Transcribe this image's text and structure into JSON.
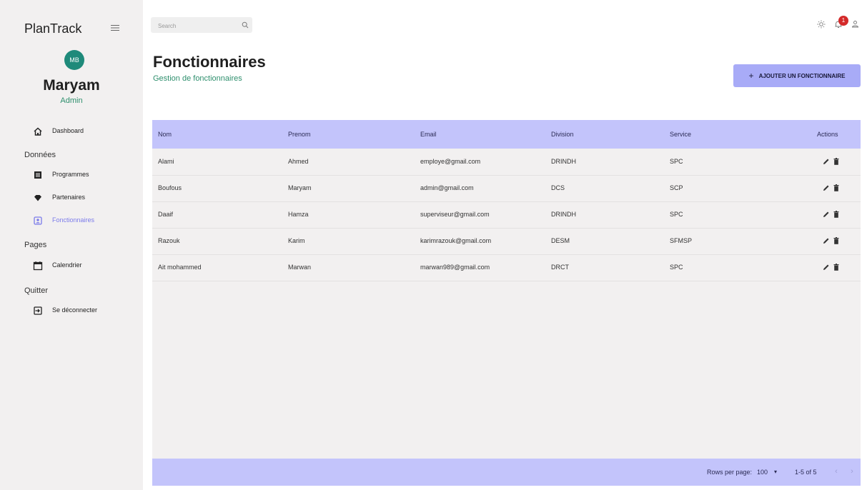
{
  "app": {
    "brand": "PlanTrack"
  },
  "user": {
    "initials": "MB",
    "name": "Maryam",
    "role": "Admin"
  },
  "sidebar": {
    "dashboard": "Dashboard",
    "section_donnees": "Données",
    "programmes": "Programmes",
    "partenaires": "Partenaires",
    "fonctionnaires": "Fonctionnaires",
    "section_pages": "Pages",
    "calendrier": "Calendrier",
    "section_quitter": "Quitter",
    "logout": "Se déconnecter",
    "active_item": "Fonctionnaires"
  },
  "header": {
    "search_placeholder": "Search",
    "notification_count": "1"
  },
  "page": {
    "title": "Fonctionnaires",
    "subtitle": "Gestion de fonctionnaires",
    "add_button": "AJOUTER UN FONCTIONNAIRE"
  },
  "table": {
    "columns": [
      "Nom",
      "Prenom",
      "Email",
      "Division",
      "Service",
      "Actions"
    ],
    "rows": [
      [
        "Alami",
        "Ahmed",
        "employe@gmail.com",
        "DRINDH",
        "SPC"
      ],
      [
        "Boufous",
        "Maryam",
        "admin@gmail.com",
        "DCS",
        "SCP"
      ],
      [
        "Daaif",
        "Hamza",
        "superviseur@gmail.com",
        "DRINDH",
        "SPC"
      ],
      [
        "Razouk",
        "Karim",
        "karimrazouk@gmail.com",
        "DESM",
        "SFMSP"
      ],
      [
        "Ait mohammed",
        "Marwan",
        "marwan989@gmail.com",
        "DRCT",
        "SPC"
      ]
    ]
  },
  "pagination": {
    "rows_per_page_label": "Rows per page:",
    "rows_per_page": "100",
    "range": "1-5 of 5"
  },
  "colors": {
    "accent": "#a8abf7",
    "header": "#c3c4fb",
    "green": "#2e8f6d",
    "avatar": "#1f8a7a",
    "badge": "#d42a2a",
    "active_nav": "#7b7bea"
  },
  "icons": {
    "menu": "hamburger-menu-icon",
    "dashboard": "home-icon",
    "programmes": "list-icon",
    "partenaires": "diamond-icon",
    "fonctionnaires": "id-badge-icon",
    "calendrier": "calendar-icon",
    "logout": "logout-icon",
    "search": "search-icon",
    "theme": "sun-icon",
    "notifications": "bell-icon",
    "account": "user-icon",
    "edit": "pencil-icon",
    "delete": "trash-icon"
  }
}
